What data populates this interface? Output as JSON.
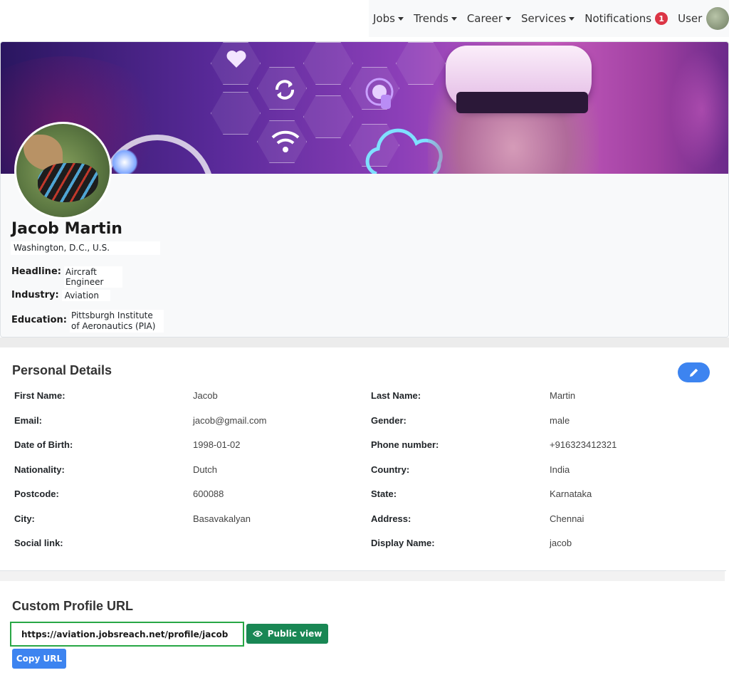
{
  "nav": {
    "items": [
      {
        "label": "Jobs"
      },
      {
        "label": "Trends"
      },
      {
        "label": "Career"
      },
      {
        "label": "Services"
      }
    ],
    "notifications_label": "Notifications",
    "notifications_count": "1",
    "user_label": "User"
  },
  "profile": {
    "name": "Jacob Martin",
    "location": "Washington, D.C., U.S.",
    "headline_label": "Headline:",
    "headline": "Aircraft Engineer",
    "industry_label": "Industry:",
    "industry": "Aviation",
    "education_label": "Education:",
    "education": "Pittsburgh Institute of Aeronautics (PIA)"
  },
  "personal_details": {
    "title": "Personal Details",
    "left": [
      {
        "label": "First Name:",
        "value": "Jacob"
      },
      {
        "label": "Email:",
        "value": "jacob@gmail.com"
      },
      {
        "label": "Date of Birth:",
        "value": "1998-01-02"
      },
      {
        "label": "Nationality:",
        "value": "Dutch"
      },
      {
        "label": "Postcode:",
        "value": "600088"
      },
      {
        "label": "City:",
        "value": "Basavakalyan"
      },
      {
        "label": "Social link:",
        "value": ""
      }
    ],
    "right": [
      {
        "label": "Last Name:",
        "value": "Martin"
      },
      {
        "label": "Gender:",
        "value": "male"
      },
      {
        "label": "Phone number:",
        "value": "+916323412321"
      },
      {
        "label": "Country:",
        "value": "India"
      },
      {
        "label": "State:",
        "value": "Karnataka"
      },
      {
        "label": "Address:",
        "value": "Chennai"
      },
      {
        "label": "Display Name:",
        "value": "jacob"
      }
    ]
  },
  "custom_url": {
    "title": "Custom Profile URL",
    "url": "https://aviation.jobsreach.net/profile/jacob",
    "public_view_label": "Public view",
    "copy_label": "Copy URL"
  },
  "colors": {
    "accent_blue": "#3d84f0",
    "success_green": "#198754",
    "badge_red": "#dc3545"
  }
}
